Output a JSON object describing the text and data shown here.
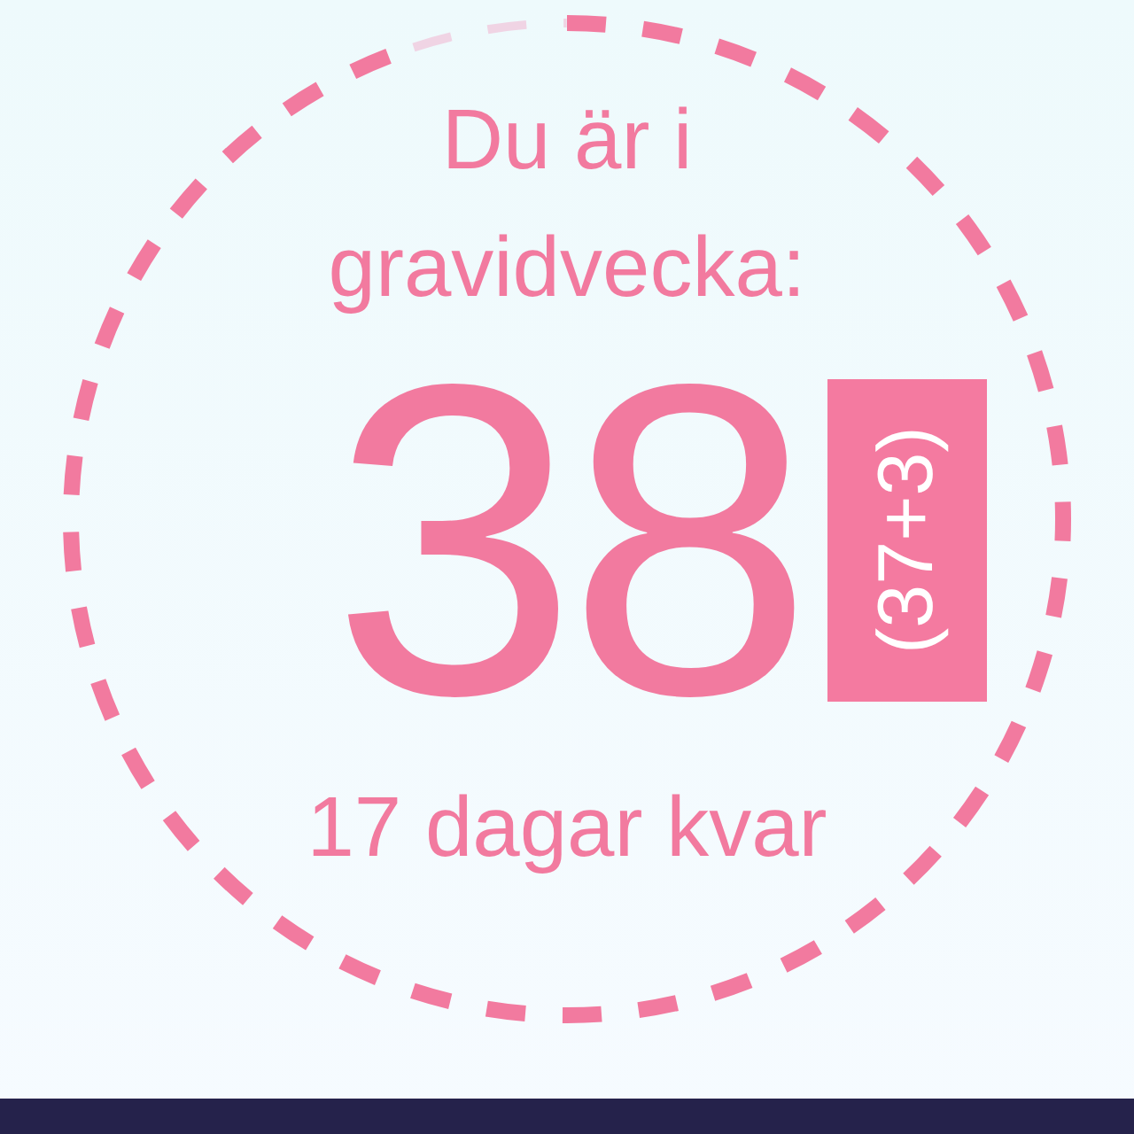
{
  "heading": [
    "Du är i",
    "gravidvecka:"
  ],
  "week": "38",
  "badge": "(37+3)",
  "remaining": "17 dagar kvar",
  "ring": {
    "level": 0.95
  }
}
